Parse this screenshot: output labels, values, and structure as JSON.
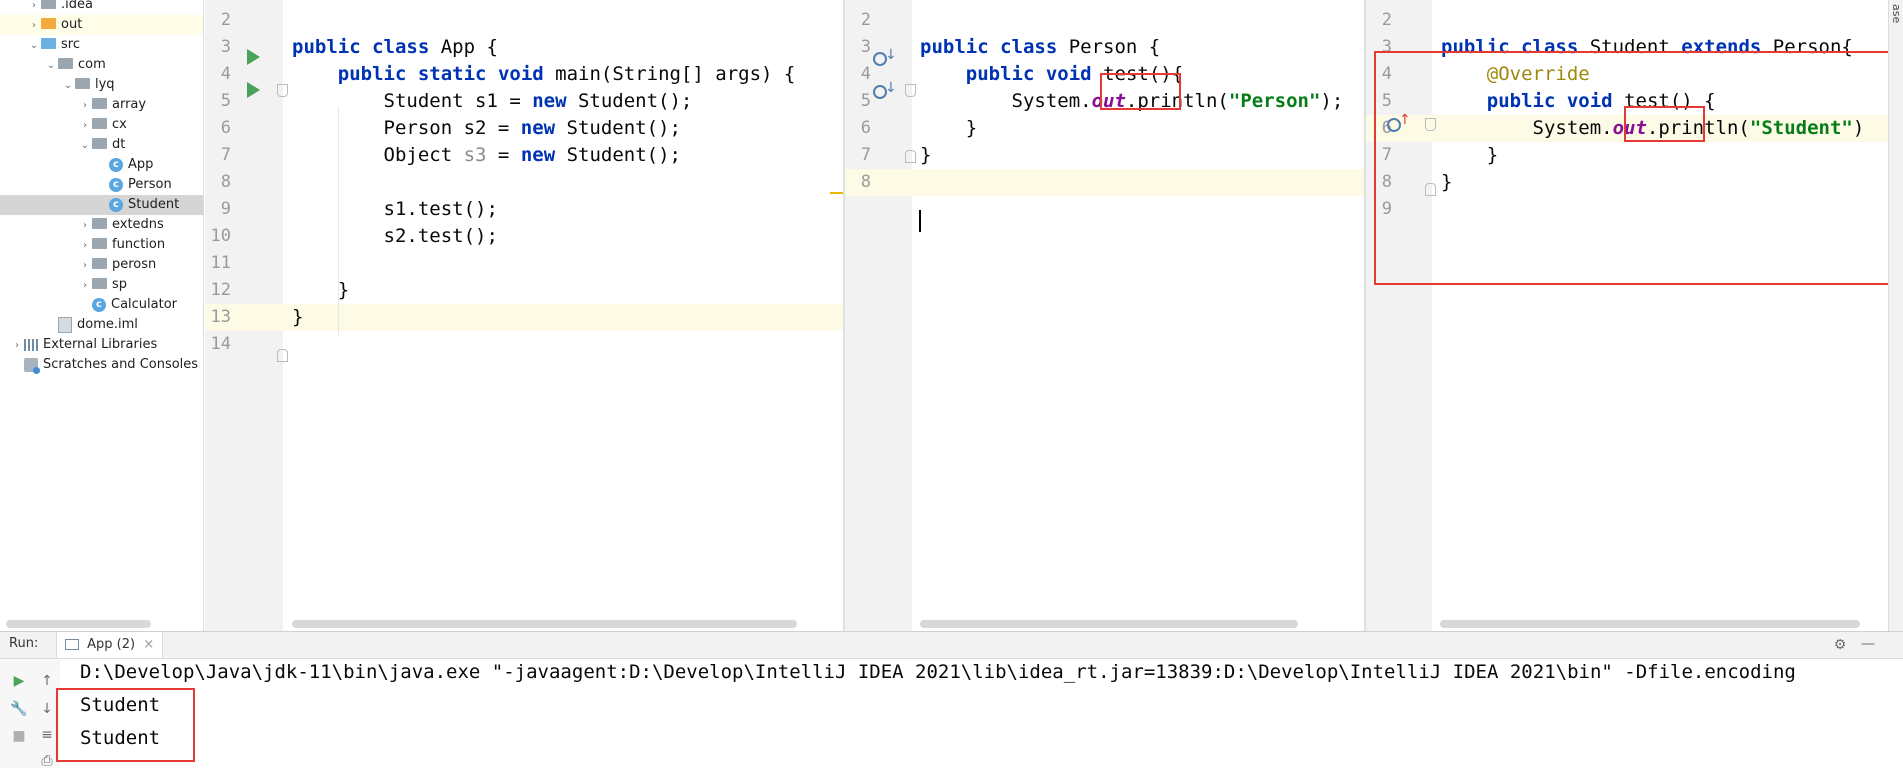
{
  "project_tree": {
    "items": [
      {
        "label": ".idea",
        "indent": 1,
        "arrow": "›",
        "icon": "folder-grey"
      },
      {
        "label": "out",
        "indent": 1,
        "arrow": "›",
        "icon": "folder-orange",
        "highlight": "yellow"
      },
      {
        "label": "src",
        "indent": 1,
        "arrow": "⌄",
        "icon": "folder-blue"
      },
      {
        "label": "com",
        "indent": 2,
        "arrow": "⌄",
        "icon": "package"
      },
      {
        "label": "lyq",
        "indent": 3,
        "arrow": "⌄",
        "icon": "package"
      },
      {
        "label": "array",
        "indent": 4,
        "arrow": "›",
        "icon": "package"
      },
      {
        "label": "cx",
        "indent": 4,
        "arrow": "›",
        "icon": "package"
      },
      {
        "label": "dt",
        "indent": 4,
        "arrow": "⌄",
        "icon": "package"
      },
      {
        "label": "App",
        "indent": 5,
        "arrow": "",
        "icon": "class"
      },
      {
        "label": "Person",
        "indent": 5,
        "arrow": "",
        "icon": "class"
      },
      {
        "label": "Student",
        "indent": 5,
        "arrow": "",
        "icon": "class",
        "highlight": "selected"
      },
      {
        "label": "extedns",
        "indent": 4,
        "arrow": "›",
        "icon": "package"
      },
      {
        "label": "function",
        "indent": 4,
        "arrow": "›",
        "icon": "package"
      },
      {
        "label": "perosn",
        "indent": 4,
        "arrow": "›",
        "icon": "package"
      },
      {
        "label": "sp",
        "indent": 4,
        "arrow": "›",
        "icon": "package"
      },
      {
        "label": "Calculator",
        "indent": 4,
        "arrow": "",
        "icon": "class"
      },
      {
        "label": "dome.iml",
        "indent": 2,
        "arrow": "",
        "icon": "iml"
      },
      {
        "label": "External Libraries",
        "indent": 0,
        "arrow": "›",
        "icon": "library"
      },
      {
        "label": "Scratches and Consoles",
        "indent": 0,
        "arrow": "",
        "icon": "scratch"
      }
    ]
  },
  "editor_app": {
    "lines": [
      {
        "num": "2",
        "code": ""
      },
      {
        "num": "3",
        "code": "public class App {"
      },
      {
        "num": "4",
        "code": "    public static void main(String[] args) {"
      },
      {
        "num": "5",
        "code": "        Student s1 = new Student();"
      },
      {
        "num": "6",
        "code": "        Person s2 = new Student();"
      },
      {
        "num": "7",
        "code": "        Object s3 = new Student();"
      },
      {
        "num": "8",
        "code": ""
      },
      {
        "num": "9",
        "code": "        s1.test();"
      },
      {
        "num": "10",
        "code": "        s2.test();"
      },
      {
        "num": "11",
        "code": ""
      },
      {
        "num": "12",
        "code": "    }"
      },
      {
        "num": "13",
        "code": "}"
      },
      {
        "num": "14",
        "code": ""
      }
    ]
  },
  "editor_person": {
    "lines": [
      {
        "num": "2",
        "code": ""
      },
      {
        "num": "3",
        "code": "public class Person {"
      },
      {
        "num": "4",
        "code": "    public void test(){"
      },
      {
        "num": "5",
        "code": "        System.out.println(\"Person\");"
      },
      {
        "num": "6",
        "code": "    }"
      },
      {
        "num": "7",
        "code": "}"
      },
      {
        "num": "8",
        "code": ""
      }
    ]
  },
  "editor_student": {
    "lines": [
      {
        "num": "2",
        "code": ""
      },
      {
        "num": "3",
        "code": "public class Student extends Person{"
      },
      {
        "num": "4",
        "code": "    @Override"
      },
      {
        "num": "5",
        "code": "    public void test() {"
      },
      {
        "num": "6",
        "code": "        System.out.println(\"Student\")"
      },
      {
        "num": "7",
        "code": "    }"
      },
      {
        "num": "8",
        "code": "}"
      },
      {
        "num": "9",
        "code": ""
      }
    ]
  },
  "right_strip_label": "ase",
  "run_panel": {
    "label": "Run:",
    "tab_label": "App (2)",
    "tab_close": "×",
    "command": "D:\\Develop\\Java\\jdk-11\\bin\\java.exe \"-javaagent:D:\\Develop\\IntelliJ IDEA 2021\\lib\\idea_rt.jar=13839:D:\\Develop\\IntelliJ IDEA 2021\\bin\" -Dfile.encoding",
    "output": [
      "Student",
      "Student"
    ]
  },
  "colors": {
    "keyword": "#0033b3",
    "string": "#067d17",
    "static_field": "#871094",
    "annotation": "#9e880d",
    "highlight_box": "#e53935",
    "current_line": "#fdfae6"
  }
}
